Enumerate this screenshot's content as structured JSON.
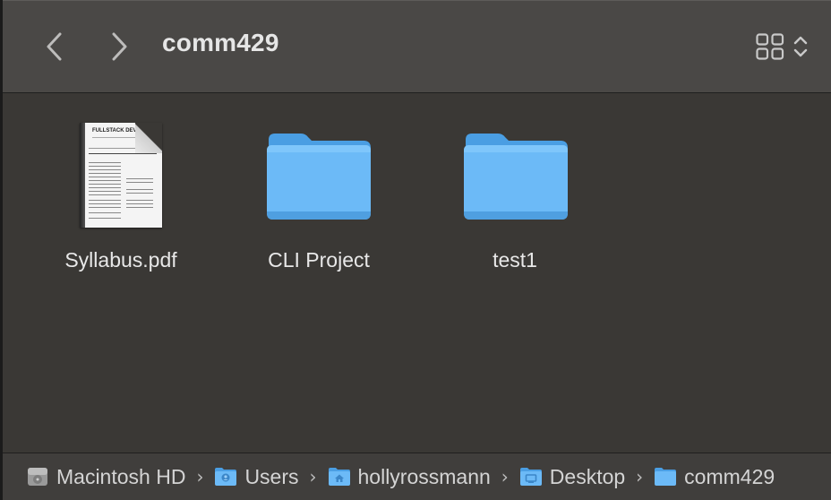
{
  "window": {
    "title": "comm429"
  },
  "toolbar": {
    "back_icon": "chevron-left-icon",
    "forward_icon": "chevron-right-icon",
    "view_icon": "icon-grid-view-icon",
    "view_selector_icon": "up-down-chevron-icon"
  },
  "files": [
    {
      "name": "Syllabus.pdf",
      "kind": "pdf",
      "thumbnail_heading": "FULLSTACK DEVELO"
    },
    {
      "name": "CLI Project",
      "kind": "folder"
    },
    {
      "name": "test1",
      "kind": "folder"
    }
  ],
  "path_bar": [
    {
      "label": "Macintosh HD",
      "icon": "hard-drive-icon"
    },
    {
      "label": "Users",
      "icon": "users-folder-icon"
    },
    {
      "label": "hollyrossmann",
      "icon": "home-folder-icon"
    },
    {
      "label": "Desktop",
      "icon": "desktop-folder-icon"
    },
    {
      "label": "comm429",
      "icon": "folder-icon"
    }
  ],
  "colors": {
    "folder_blue": "#5aaef0",
    "folder_tab": "#4a9ee3",
    "window_bg": "#3a3835",
    "toolbar_bg": "#4a4846",
    "text": "#e8e8e8"
  }
}
